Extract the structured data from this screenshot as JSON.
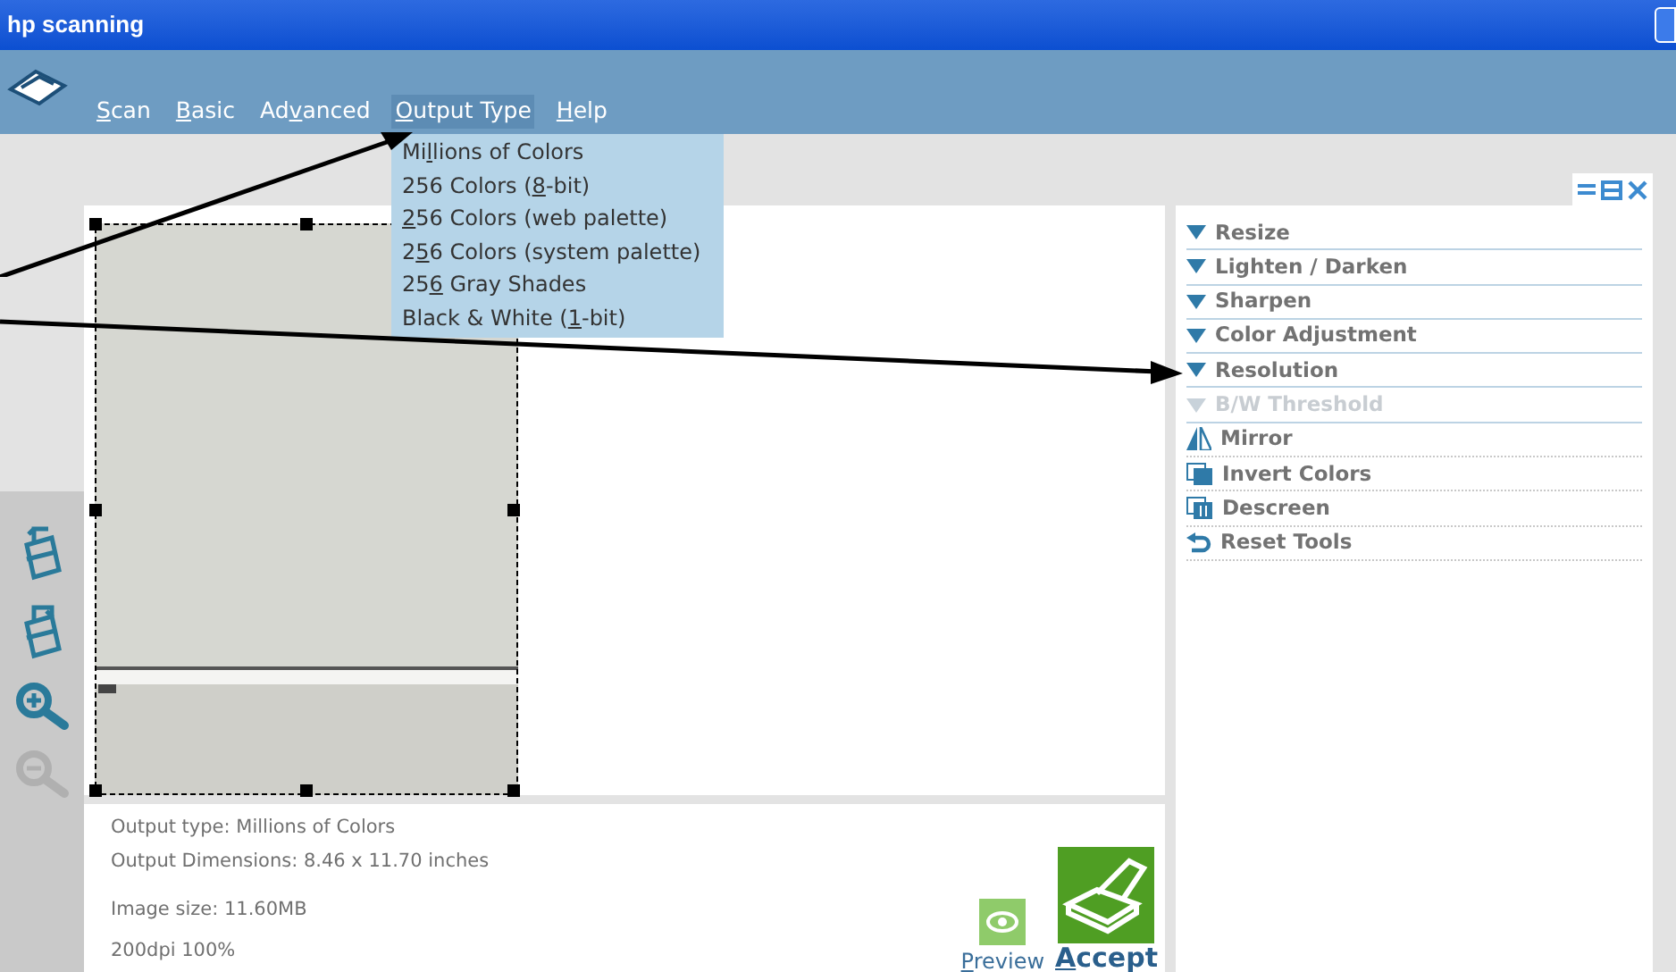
{
  "window": {
    "title": "hp scanning"
  },
  "menu": [
    {
      "parts": {
        "key": "S",
        "after": "can"
      },
      "open": false
    },
    {
      "parts": {
        "key": "B",
        "after": "asic"
      },
      "open": false
    },
    {
      "parts": {
        "before": "Ad",
        "key": "v",
        "after": "anced"
      },
      "open": false
    },
    {
      "parts": {
        "key": "O",
        "after": "utput Type"
      },
      "open": true
    },
    {
      "parts": {
        "key": "H",
        "after": "elp"
      },
      "open": false
    }
  ],
  "output_type_menu": [
    {
      "parts": {
        "before": "Mi",
        "key": "l",
        "after": "lions of Colors"
      }
    },
    {
      "parts": {
        "before": "256 Colors (",
        "key": "8",
        "after": "-bit)"
      }
    },
    {
      "parts": {
        "key": "2",
        "after": "56 Colors (web palette)"
      }
    },
    {
      "parts": {
        "before": "2",
        "key": "5",
        "after": "6 Colors (system palette)"
      }
    },
    {
      "parts": {
        "before": "25",
        "key": "6",
        "after": " Gray Shades"
      }
    },
    {
      "parts": {
        "before": "Black & White (",
        "key": "1",
        "after": "-bit)"
      }
    }
  ],
  "left_toolbar": [
    {
      "kind": "rotate-left",
      "disabled": false
    },
    {
      "kind": "rotate-right",
      "disabled": false
    },
    {
      "kind": "zoom-in",
      "disabled": false
    },
    {
      "kind": "zoom-out",
      "disabled": true
    }
  ],
  "tools": [
    {
      "kind": "section",
      "label": "Resize",
      "disabled": false
    },
    {
      "kind": "section",
      "label": "Lighten / Darken",
      "disabled": false
    },
    {
      "kind": "section",
      "label": "Sharpen",
      "disabled": false
    },
    {
      "kind": "section",
      "label": "Color Adjustment",
      "disabled": false
    },
    {
      "kind": "section",
      "label": "Resolution",
      "disabled": false
    },
    {
      "kind": "section",
      "label": "B/W Threshold",
      "disabled": true
    },
    {
      "kind": "mirror",
      "label": "Mirror",
      "disabled": false
    },
    {
      "kind": "invert",
      "label": "Invert Colors",
      "disabled": false
    },
    {
      "kind": "descreen",
      "label": "Descreen",
      "disabled": false
    },
    {
      "kind": "reset",
      "label": "Reset Tools",
      "disabled": false
    }
  ],
  "info": [
    "Output type: Millions of Colors",
    "Output Dimensions: 8.46 x 11.70 inches",
    "Image size: 11.60MB",
    "200dpi  100%"
  ],
  "preview_button": {
    "parts": {
      "key": "P",
      "after": "review"
    }
  },
  "accept_button": {
    "parts": {
      "key": "A",
      "after": "ccept"
    }
  }
}
